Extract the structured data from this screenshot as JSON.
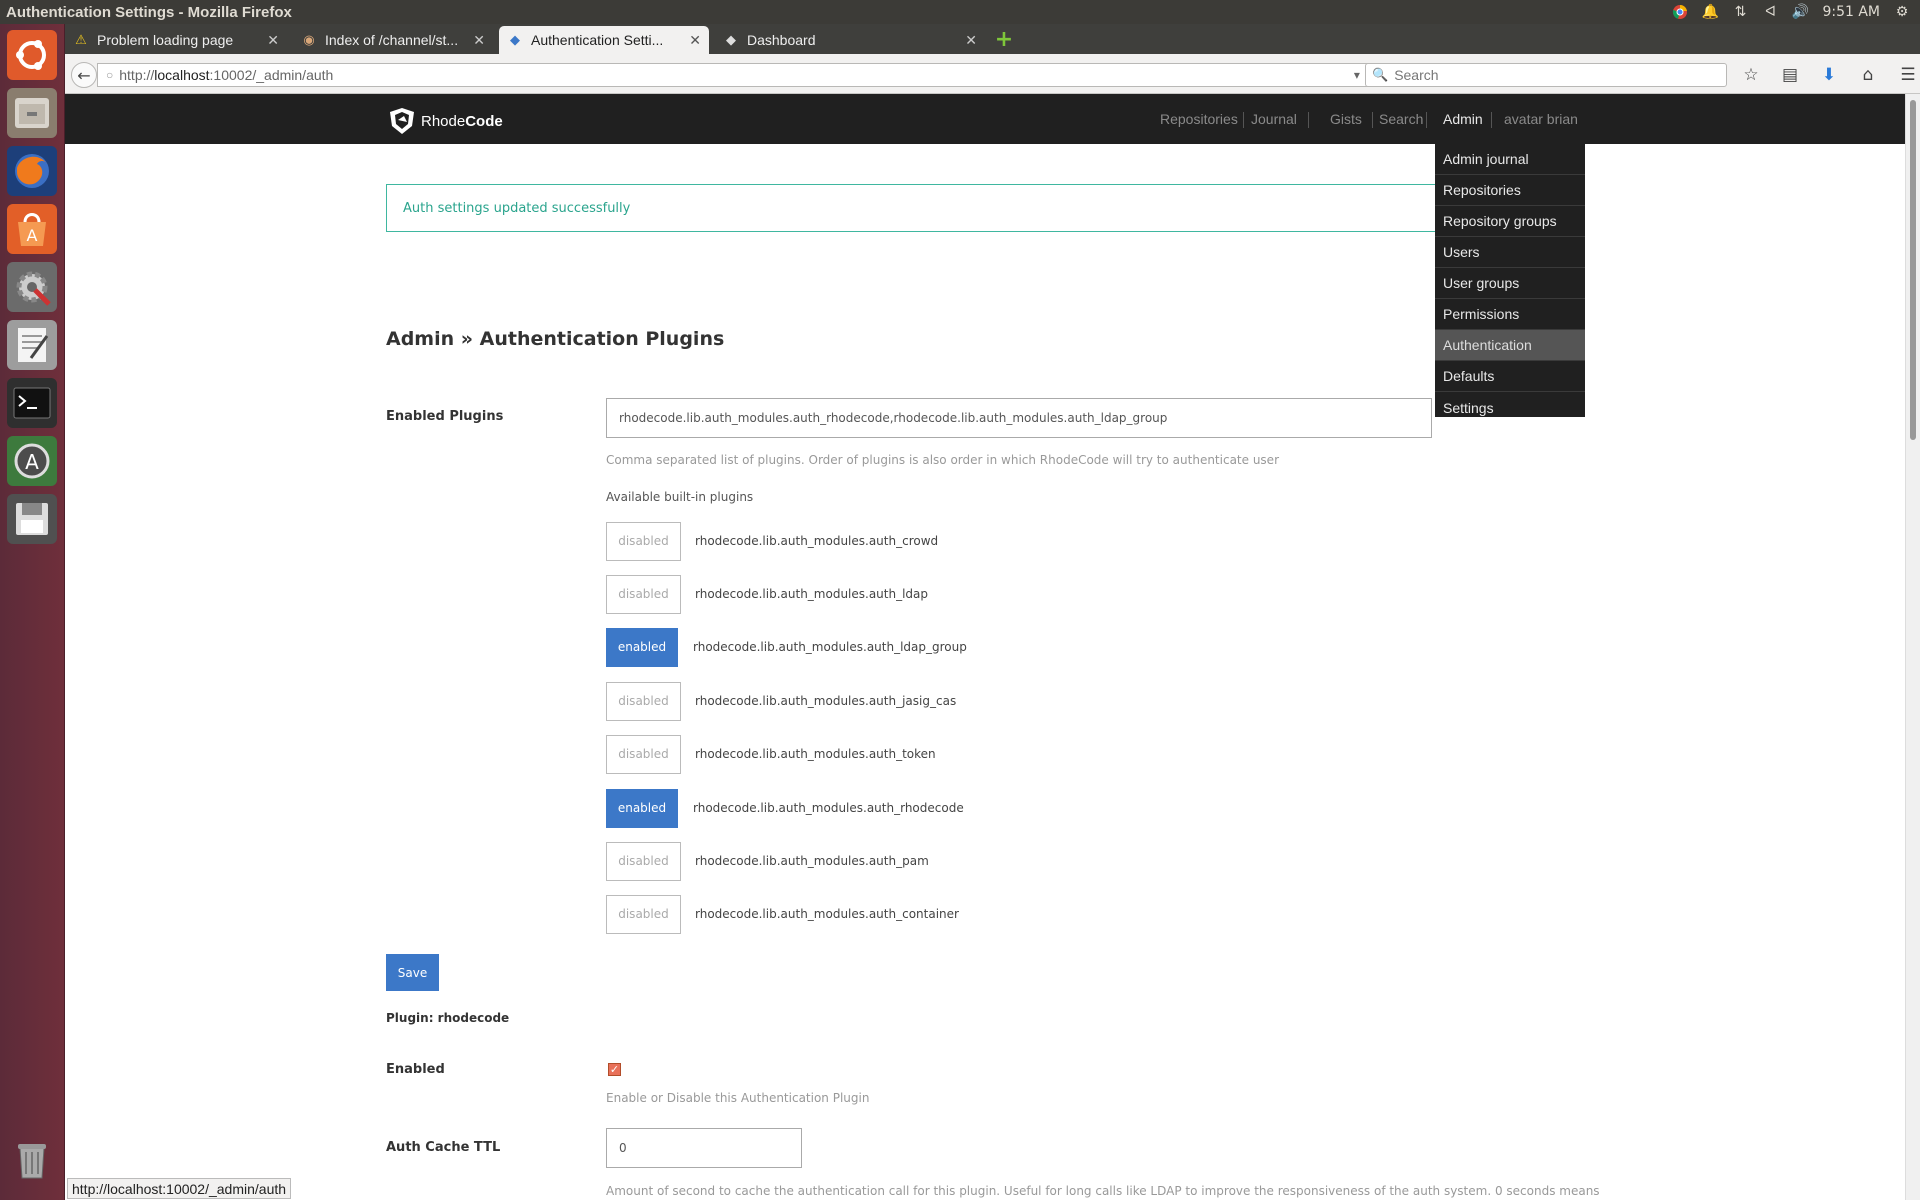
{
  "system": {
    "window_title": "Authentication Settings - Mozilla Firefox",
    "clock": "9:51 AM"
  },
  "tabs": [
    {
      "title": "Problem loading page",
      "icon": "warning-icon"
    },
    {
      "title": "Index of /channel/st...",
      "icon": "page-icon"
    },
    {
      "title": "Authentication Setti...",
      "icon": "rhodecode-icon"
    },
    {
      "title": "Dashboard",
      "icon": "rhodecode-icon"
    }
  ],
  "browser": {
    "url_prefix": "http://",
    "url_host": "localhost",
    "url_rest": ":10002/_admin/auth",
    "search_placeholder": "Search"
  },
  "rc_header": {
    "brand_light": "Rhode",
    "brand_bold": "Code",
    "nav": [
      "Repositories",
      "Journal",
      "Gists",
      "Search",
      "Admin",
      "avatar brian"
    ]
  },
  "admin_menu": [
    "Admin journal",
    "Repositories",
    "Repository groups",
    "Users",
    "User groups",
    "Permissions",
    "Authentication",
    "Defaults",
    "Settings"
  ],
  "flash": "Auth settings updated successfully",
  "page_title": "Admin » Authentication Plugins",
  "form": {
    "enabled_plugins_label": "Enabled Plugins",
    "enabled_plugins_value": "rhodecode.lib.auth_modules.auth_rhodecode,rhodecode.lib.auth_modules.auth_ldap_group",
    "enabled_plugins_help": "Comma separated list of plugins. Order of plugins is also order in which RhodeCode will try to authenticate user",
    "available_title": "Available built-in plugins",
    "plugins": [
      {
        "state": "disabled",
        "name": "rhodecode.lib.auth_modules.auth_crowd"
      },
      {
        "state": "disabled",
        "name": "rhodecode.lib.auth_modules.auth_ldap"
      },
      {
        "state": "enabled",
        "name": "rhodecode.lib.auth_modules.auth_ldap_group"
      },
      {
        "state": "disabled",
        "name": "rhodecode.lib.auth_modules.auth_jasig_cas"
      },
      {
        "state": "disabled",
        "name": "rhodecode.lib.auth_modules.auth_token"
      },
      {
        "state": "enabled",
        "name": "rhodecode.lib.auth_modules.auth_rhodecode"
      },
      {
        "state": "disabled",
        "name": "rhodecode.lib.auth_modules.auth_pam"
      },
      {
        "state": "disabled",
        "name": "rhodecode.lib.auth_modules.auth_container"
      }
    ],
    "save_label": "Save",
    "plugin_heading": "Plugin: rhodecode",
    "enabled_label": "Enabled",
    "enabled_checked": true,
    "enabled_help": "Enable or Disable this Authentication Plugin",
    "ttl_label": "Auth Cache TTL",
    "ttl_value": "0",
    "ttl_help": "Amount of second to cache the authentication call for this plugin. Useful for long calls like LDAP to improve the responsiveness of the auth system. 0 seconds means"
  },
  "status_bar_url": "http://localhost:10002/_admin/auth",
  "colors": {
    "accent": "#3c78c8",
    "success": "#3fb7a0",
    "header_bg": "#202020"
  }
}
